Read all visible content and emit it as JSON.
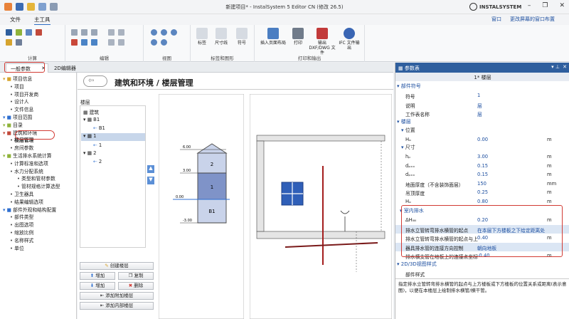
{
  "window": {
    "title": "新建项目* - InstalSystem 5 Editor CN (修改 26.5)",
    "brand": "INSTALSYSTEM"
  },
  "menu": {
    "file": "文件",
    "main_tools": "主工具",
    "window": "窗口",
    "layout_hint": "更改屏幕的窗口布置"
  },
  "ribbon": {
    "groups": [
      "计算",
      "编辑",
      "视图",
      "标签和图形",
      "打印和输出"
    ],
    "buttons": {
      "insert_page_layout": "插入页面布局",
      "print": "打印",
      "export_dxf": "输出 DXF/DWG 文件",
      "ifc": "IFC 文件输出",
      "label": "标签",
      "dimension": "尺寸线",
      "symbol": "符号"
    }
  },
  "tabs": [
    "一般参数",
    "2D编辑器"
  ],
  "tree": [
    {
      "label": "项目信息",
      "level": 0
    },
    {
      "label": "项目",
      "level": 1
    },
    {
      "label": "项目开发商",
      "level": 1
    },
    {
      "label": "设计人",
      "level": 1
    },
    {
      "label": "文件信息",
      "level": 1
    },
    {
      "label": "项目范围",
      "level": 0
    },
    {
      "label": "目录",
      "level": 0
    },
    {
      "label": "建筑和环境",
      "level": 0
    },
    {
      "label": "楼层管理",
      "level": 1
    },
    {
      "label": "房间参数",
      "level": 1
    },
    {
      "label": "生活排水系统计算",
      "level": 0
    },
    {
      "label": "计算标准和选项",
      "level": 1
    },
    {
      "label": "水力分配系统",
      "level": 1
    },
    {
      "label": "类型和管材参数",
      "level": 2
    },
    {
      "label": "管材规格计算选型",
      "level": 2
    },
    {
      "label": "卫生器具",
      "level": 1
    },
    {
      "label": "结果编辑选项",
      "level": 1
    },
    {
      "label": "部件外观和结构配置",
      "level": 0
    },
    {
      "label": "部件类型",
      "level": 1
    },
    {
      "label": "出图选项",
      "level": 1
    },
    {
      "label": "缩放比例",
      "level": 1
    },
    {
      "label": "名称样式",
      "level": 1
    },
    {
      "label": "单位",
      "level": 1
    }
  ],
  "main": {
    "title": "建筑和环境 / 楼层管理",
    "floors_label": "楼层",
    "floor_items": [
      "建筑",
      "B1",
      "B1",
      "1",
      "1",
      "2",
      "2"
    ],
    "building_blocks": [
      "2",
      "1",
      "B1"
    ],
    "levels": [
      "6.00",
      "3.00",
      "0.00",
      "-3.00"
    ],
    "buttons": {
      "create_floor": "创建楼层",
      "add": "增加",
      "copy": "复制",
      "add2": "增加",
      "delete": "删除",
      "add_attached": "添加附加楼层",
      "add_internal": "添加内部楼层"
    }
  },
  "panel": {
    "title": "参数表",
    "subtitle": "1* 楼层",
    "section_parts": "部件符号",
    "rows_parts": [
      {
        "k": "符号",
        "v": "1",
        "u": ""
      },
      {
        "k": "说明",
        "v": "层",
        "u": ""
      },
      {
        "k": "工作表名称",
        "v": "层",
        "u": ""
      }
    ],
    "section_floor": "楼层",
    "sub_position": "位置",
    "rows_position": [
      {
        "k": "Hₒ",
        "v": "0.00",
        "u": "m"
      }
    ],
    "sub_size": "尺寸",
    "rows_size": [
      {
        "k": "hₚ",
        "v": "3.00",
        "u": "m"
      },
      {
        "k": "dₚₓₓ",
        "v": "0.15",
        "u": "m"
      },
      {
        "k": "dₚₓₓ",
        "v": "0.15",
        "u": "m"
      },
      {
        "k": "地面厚度（不含装饰面层）",
        "v": "150",
        "u": "mm"
      },
      {
        "k": "吊顶厚度",
        "v": "0.25",
        "u": "m"
      },
      {
        "k": "Hₒ",
        "v": "0.80",
        "u": "m"
      }
    ],
    "section_drain": "室内排水",
    "rows_drain": [
      {
        "k": "ΔHₗₗₗₗₗ",
        "v": "0.20",
        "u": "m"
      },
      {
        "k": "排水立管转弯排水横管的起点",
        "v": "在本层下方楼板之下给定距离处",
        "u": ""
      },
      {
        "k": "排水立管转弯排水横管的起点与上",
        "v": "0.40",
        "u": "m"
      },
      {
        "k": "器具排水管的连接方向控制",
        "v": "朝向地板",
        "u": ""
      },
      {
        "k": "排水横支管在地板上的连接点坐标",
        "v": "-0.40",
        "u": "m"
      }
    ],
    "section_2d3d": "2D/3D视图样式",
    "rows_style": [
      {
        "k": "部件样式",
        "v": "",
        "u": ""
      }
    ],
    "description": "指定排水立管转弯排水横管的起点与上方楼板或下方楼板的位置关系或距离(表示意图)，以便在本楼层上绘制排水横管/横干管。"
  },
  "colors": {
    "accent": "#2f5f9e",
    "highlight": "#d23b34",
    "floor_blue": "#7f93c8"
  }
}
